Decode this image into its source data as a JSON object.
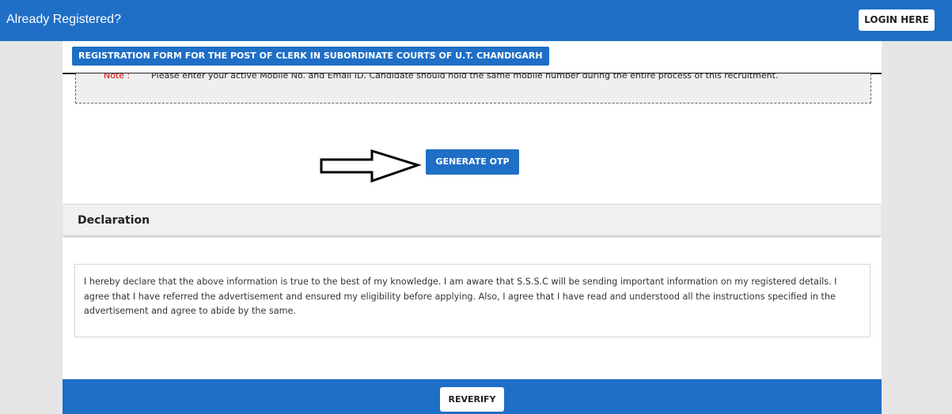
{
  "header": {
    "title": "Already Registered?",
    "login_label": "LOGIN HERE",
    "color": "#1f6fc6"
  },
  "form": {
    "title": "REGISTRATION FORM FOR THE POST OF CLERK IN SUBORDINATE COURTS OF U.T. CHANDIGARH",
    "note_label": "Note :",
    "note_text": "Please enter your active Mobile No. and Email ID. Candidate should hold the same mobile number during the entire process of this recruitment.",
    "generate_otp_label": "GENERATE OTP"
  },
  "declaration": {
    "title": "Declaration",
    "text": "I hereby declare that the above information is true to the best of my knowledge. I am aware that S.S.S.C will be sending important information on my registered details. I agree that I have referred the advertisement and ensured my eligibility before applying. Also, I agree that I have read and understood all the instructions specified in the advertisement and agree to abide by the same."
  },
  "footer": {
    "reverify_label": "REVERIFY"
  },
  "icons": {
    "arrow": "right-arrow-icon"
  }
}
